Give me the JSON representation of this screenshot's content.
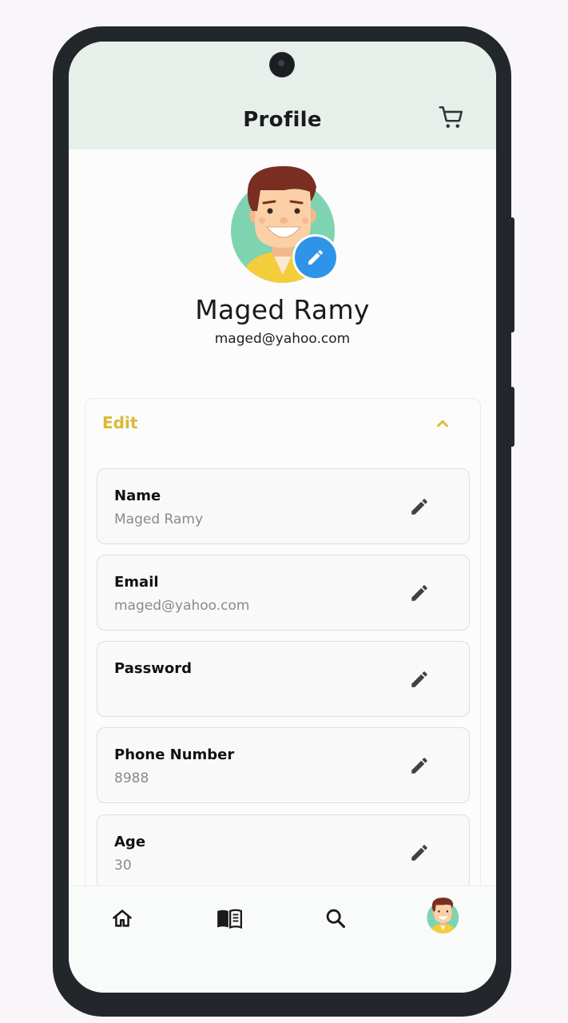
{
  "app_bar": {
    "title": "Profile",
    "cart_icon": "shopping-cart-icon"
  },
  "profile": {
    "name": "Maged Ramy",
    "email": "maged@yahoo.com",
    "edit_avatar_icon": "pencil-icon",
    "avatar_colors": {
      "background": "#7ed3b0",
      "hair": "#7a2e22",
      "skin": "#fbd0a6",
      "shirt": "#f4cd3b"
    }
  },
  "edit_section": {
    "title": "Edit",
    "expanded": true,
    "accent_color": "#dcb937",
    "fields": [
      {
        "label": "Name",
        "value": "Maged Ramy"
      },
      {
        "label": "Email",
        "value": "maged@yahoo.com"
      },
      {
        "label": "Password",
        "value": ""
      },
      {
        "label": "Phone Number",
        "value": "8988"
      },
      {
        "label": "Age",
        "value": "30"
      }
    ]
  },
  "bottom_nav": {
    "items": [
      {
        "name": "home",
        "icon": "home-icon"
      },
      {
        "name": "library",
        "icon": "book-icon"
      },
      {
        "name": "search",
        "icon": "search-icon"
      },
      {
        "name": "profile",
        "icon": "avatar"
      }
    ]
  }
}
